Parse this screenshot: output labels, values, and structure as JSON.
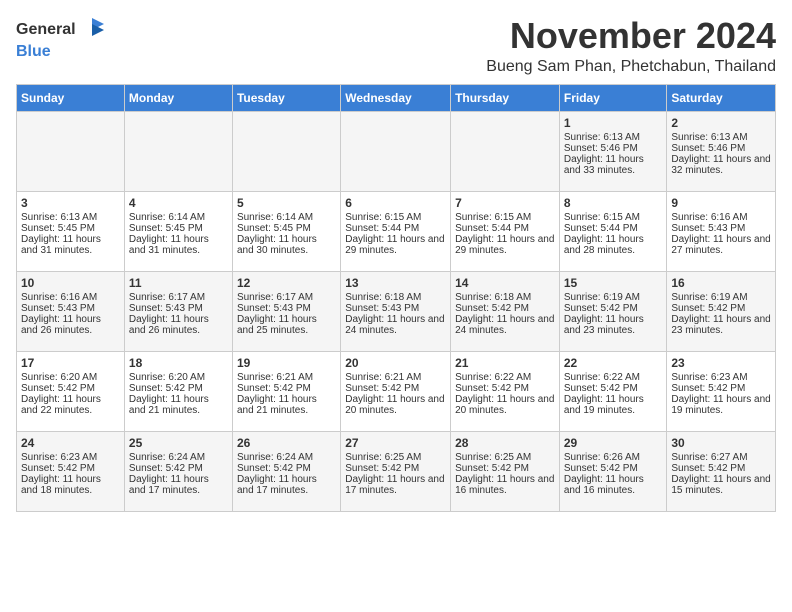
{
  "header": {
    "logo_general": "General",
    "logo_blue": "Blue",
    "month_title": "November 2024",
    "location": "Bueng Sam Phan, Phetchabun, Thailand"
  },
  "weekdays": [
    "Sunday",
    "Monday",
    "Tuesday",
    "Wednesday",
    "Thursday",
    "Friday",
    "Saturday"
  ],
  "weeks": [
    [
      {
        "day": "",
        "sunrise": "",
        "sunset": "",
        "daylight": ""
      },
      {
        "day": "",
        "sunrise": "",
        "sunset": "",
        "daylight": ""
      },
      {
        "day": "",
        "sunrise": "",
        "sunset": "",
        "daylight": ""
      },
      {
        "day": "",
        "sunrise": "",
        "sunset": "",
        "daylight": ""
      },
      {
        "day": "",
        "sunrise": "",
        "sunset": "",
        "daylight": ""
      },
      {
        "day": "1",
        "sunrise": "Sunrise: 6:13 AM",
        "sunset": "Sunset: 5:46 PM",
        "daylight": "Daylight: 11 hours and 33 minutes."
      },
      {
        "day": "2",
        "sunrise": "Sunrise: 6:13 AM",
        "sunset": "Sunset: 5:46 PM",
        "daylight": "Daylight: 11 hours and 32 minutes."
      }
    ],
    [
      {
        "day": "3",
        "sunrise": "Sunrise: 6:13 AM",
        "sunset": "Sunset: 5:45 PM",
        "daylight": "Daylight: 11 hours and 31 minutes."
      },
      {
        "day": "4",
        "sunrise": "Sunrise: 6:14 AM",
        "sunset": "Sunset: 5:45 PM",
        "daylight": "Daylight: 11 hours and 31 minutes."
      },
      {
        "day": "5",
        "sunrise": "Sunrise: 6:14 AM",
        "sunset": "Sunset: 5:45 PM",
        "daylight": "Daylight: 11 hours and 30 minutes."
      },
      {
        "day": "6",
        "sunrise": "Sunrise: 6:15 AM",
        "sunset": "Sunset: 5:44 PM",
        "daylight": "Daylight: 11 hours and 29 minutes."
      },
      {
        "day": "7",
        "sunrise": "Sunrise: 6:15 AM",
        "sunset": "Sunset: 5:44 PM",
        "daylight": "Daylight: 11 hours and 29 minutes."
      },
      {
        "day": "8",
        "sunrise": "Sunrise: 6:15 AM",
        "sunset": "Sunset: 5:44 PM",
        "daylight": "Daylight: 11 hours and 28 minutes."
      },
      {
        "day": "9",
        "sunrise": "Sunrise: 6:16 AM",
        "sunset": "Sunset: 5:43 PM",
        "daylight": "Daylight: 11 hours and 27 minutes."
      }
    ],
    [
      {
        "day": "10",
        "sunrise": "Sunrise: 6:16 AM",
        "sunset": "Sunset: 5:43 PM",
        "daylight": "Daylight: 11 hours and 26 minutes."
      },
      {
        "day": "11",
        "sunrise": "Sunrise: 6:17 AM",
        "sunset": "Sunset: 5:43 PM",
        "daylight": "Daylight: 11 hours and 26 minutes."
      },
      {
        "day": "12",
        "sunrise": "Sunrise: 6:17 AM",
        "sunset": "Sunset: 5:43 PM",
        "daylight": "Daylight: 11 hours and 25 minutes."
      },
      {
        "day": "13",
        "sunrise": "Sunrise: 6:18 AM",
        "sunset": "Sunset: 5:43 PM",
        "daylight": "Daylight: 11 hours and 24 minutes."
      },
      {
        "day": "14",
        "sunrise": "Sunrise: 6:18 AM",
        "sunset": "Sunset: 5:42 PM",
        "daylight": "Daylight: 11 hours and 24 minutes."
      },
      {
        "day": "15",
        "sunrise": "Sunrise: 6:19 AM",
        "sunset": "Sunset: 5:42 PM",
        "daylight": "Daylight: 11 hours and 23 minutes."
      },
      {
        "day": "16",
        "sunrise": "Sunrise: 6:19 AM",
        "sunset": "Sunset: 5:42 PM",
        "daylight": "Daylight: 11 hours and 23 minutes."
      }
    ],
    [
      {
        "day": "17",
        "sunrise": "Sunrise: 6:20 AM",
        "sunset": "Sunset: 5:42 PM",
        "daylight": "Daylight: 11 hours and 22 minutes."
      },
      {
        "day": "18",
        "sunrise": "Sunrise: 6:20 AM",
        "sunset": "Sunset: 5:42 PM",
        "daylight": "Daylight: 11 hours and 21 minutes."
      },
      {
        "day": "19",
        "sunrise": "Sunrise: 6:21 AM",
        "sunset": "Sunset: 5:42 PM",
        "daylight": "Daylight: 11 hours and 21 minutes."
      },
      {
        "day": "20",
        "sunrise": "Sunrise: 6:21 AM",
        "sunset": "Sunset: 5:42 PM",
        "daylight": "Daylight: 11 hours and 20 minutes."
      },
      {
        "day": "21",
        "sunrise": "Sunrise: 6:22 AM",
        "sunset": "Sunset: 5:42 PM",
        "daylight": "Daylight: 11 hours and 20 minutes."
      },
      {
        "day": "22",
        "sunrise": "Sunrise: 6:22 AM",
        "sunset": "Sunset: 5:42 PM",
        "daylight": "Daylight: 11 hours and 19 minutes."
      },
      {
        "day": "23",
        "sunrise": "Sunrise: 6:23 AM",
        "sunset": "Sunset: 5:42 PM",
        "daylight": "Daylight: 11 hours and 19 minutes."
      }
    ],
    [
      {
        "day": "24",
        "sunrise": "Sunrise: 6:23 AM",
        "sunset": "Sunset: 5:42 PM",
        "daylight": "Daylight: 11 hours and 18 minutes."
      },
      {
        "day": "25",
        "sunrise": "Sunrise: 6:24 AM",
        "sunset": "Sunset: 5:42 PM",
        "daylight": "Daylight: 11 hours and 17 minutes."
      },
      {
        "day": "26",
        "sunrise": "Sunrise: 6:24 AM",
        "sunset": "Sunset: 5:42 PM",
        "daylight": "Daylight: 11 hours and 17 minutes."
      },
      {
        "day": "27",
        "sunrise": "Sunrise: 6:25 AM",
        "sunset": "Sunset: 5:42 PM",
        "daylight": "Daylight: 11 hours and 17 minutes."
      },
      {
        "day": "28",
        "sunrise": "Sunrise: 6:25 AM",
        "sunset": "Sunset: 5:42 PM",
        "daylight": "Daylight: 11 hours and 16 minutes."
      },
      {
        "day": "29",
        "sunrise": "Sunrise: 6:26 AM",
        "sunset": "Sunset: 5:42 PM",
        "daylight": "Daylight: 11 hours and 16 minutes."
      },
      {
        "day": "30",
        "sunrise": "Sunrise: 6:27 AM",
        "sunset": "Sunset: 5:42 PM",
        "daylight": "Daylight: 11 hours and 15 minutes."
      }
    ]
  ]
}
